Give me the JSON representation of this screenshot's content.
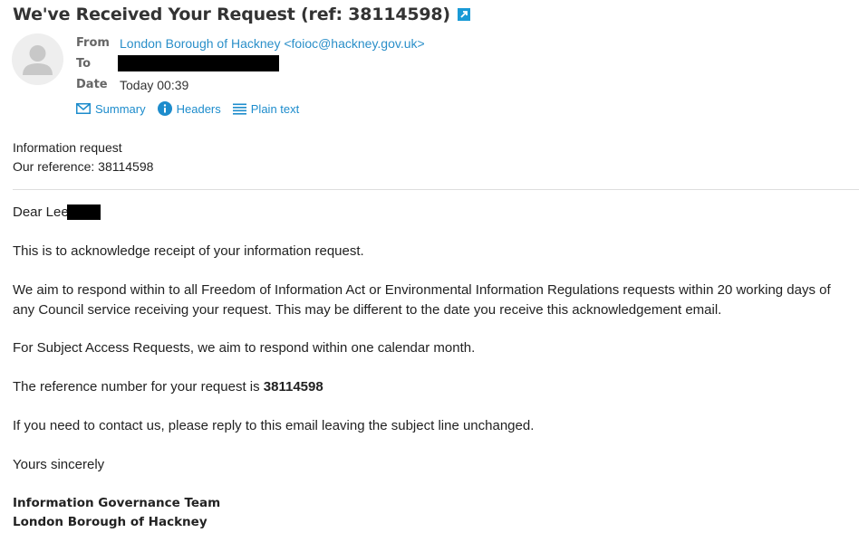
{
  "email": {
    "subject": "We've Received Your Request (ref: 38114598)",
    "open_icon": "external-link-icon",
    "headers": {
      "from_label": "From",
      "from_value": "London Borough of Hackney <foioc@hackney.gov.uk>",
      "to_label": "To",
      "date_label": "Date",
      "date_value": "Today 00:39"
    },
    "view_options": [
      {
        "label": "Summary",
        "icon": "envelope-icon"
      },
      {
        "label": "Headers",
        "icon": "info-icon"
      },
      {
        "label": "Plain text",
        "icon": "lines-icon"
      }
    ],
    "colors": {
      "link": "#2a8fc9",
      "accent": "#1a9ad6"
    }
  },
  "body": {
    "meta_line1": "Information request",
    "meta_line2": "Our reference: 38114598",
    "greeting": "Dear Lee",
    "p1": "This is to acknowledge receipt of your information request.",
    "p2": "We aim to respond within to all Freedom of Information Act or Environmental Information Regulations requests within 20 working days of any Council service receiving your request. This may be different to the date you receive this acknowledgement email.",
    "p3": "For Subject Access Requests, we aim to respond within one calendar month.",
    "p4_prefix": "The reference number for your request is ",
    "p4_ref": "38114598",
    "p5": "If you need to contact us, please reply to this email leaving the subject line unchanged.",
    "closing": "Yours sincerely",
    "sig_line1": "Information Governance Team",
    "sig_line2": "London Borough of Hackney"
  }
}
